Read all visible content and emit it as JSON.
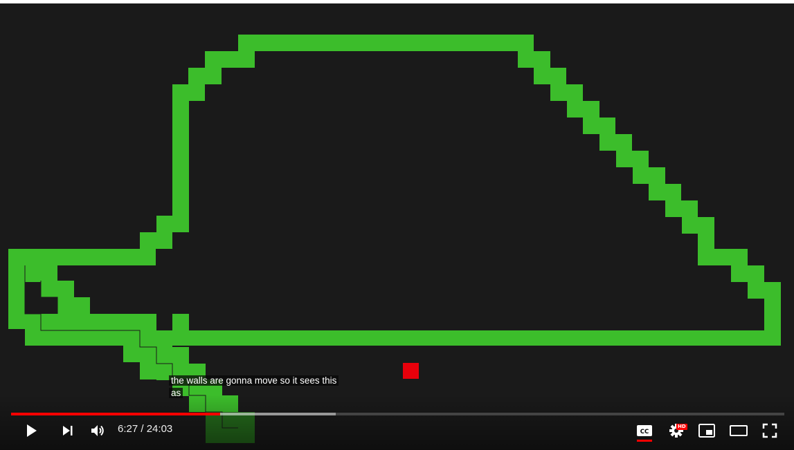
{
  "video": {
    "caption_line1": "the walls are gonna move so it sees this",
    "caption_line2": "as",
    "time_current": "6:27",
    "time_separator": " / ",
    "time_total": "24:03",
    "progress_played_fraction": 0.27,
    "progress_loaded_fraction": 0.42,
    "hd_badge": "HD",
    "cc_label": "CC"
  },
  "colors": {
    "track": "#3cbd2b",
    "car": "#e8000b",
    "background": "#1a1a1a",
    "progress_played": "#ff0000"
  },
  "icons": {
    "play": "play-icon",
    "next": "next-icon",
    "volume": "volume-icon",
    "captions": "captions-icon",
    "settings": "settings-icon",
    "miniplayer": "miniplayer-icon",
    "theater": "theater-icon",
    "fullscreen": "fullscreen-icon"
  }
}
